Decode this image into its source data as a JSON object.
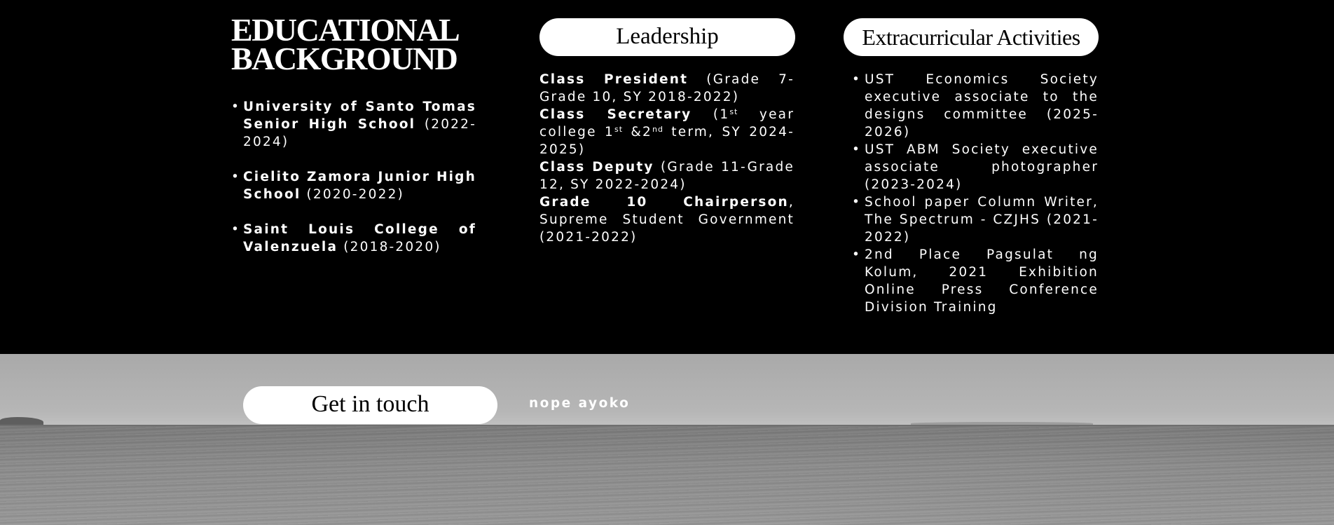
{
  "education": {
    "title_line1": "EDUCATIONAL",
    "title_line2": "BACKGROUND",
    "items": [
      {
        "name": "University of Santo Tomas Senior High School",
        "years": " (2022-2024)"
      },
      {
        "name": "Cielito Zamora Junior High School",
        "years": " (2020-2022)"
      },
      {
        "name": "Saint Louis College of Valenzuela",
        "years": " (2018-2020)"
      }
    ]
  },
  "leadership": {
    "heading": "Leadership",
    "president_title": "Class President",
    "president_detail": " (Grade 7-Grade 10, SY 2018-2022)",
    "secretary_title": "Class Secretary",
    "secretary_part1": " (1",
    "secretary_sup1": "st",
    "secretary_part2": " year college 1",
    "secretary_sup2": "st",
    "secretary_part3": " &2",
    "secretary_sup3": "nd",
    "secretary_part4": " term, SY 2024-2025)",
    "deputy_title": "Class Deputy",
    "deputy_detail": " (Grade 11-Grade 12, SY 2022-2024)",
    "chair_title": "Grade 10 Chairperson",
    "chair_detail": ", Supreme Student Government (2021-2022)"
  },
  "extracurricular": {
    "heading": "Extracurricular Activities",
    "items": [
      "UST Economics Society executive associate to the designs committee (2025-2026)",
      "UST ABM Society executive associate photographer (2023-2024)",
      "School paper Column Writer, The Spectrum - CZJHS (2021-2022)",
      "2nd Place Pagsulat ng Kolum, 2021 Exhibition Online Press Conference Division Training"
    ]
  },
  "contact": {
    "button_label": "Get in touch",
    "note": "nope ayoko"
  },
  "colors": {
    "background": "#000000",
    "pill": "#ffffff",
    "text": "#ffffff"
  }
}
